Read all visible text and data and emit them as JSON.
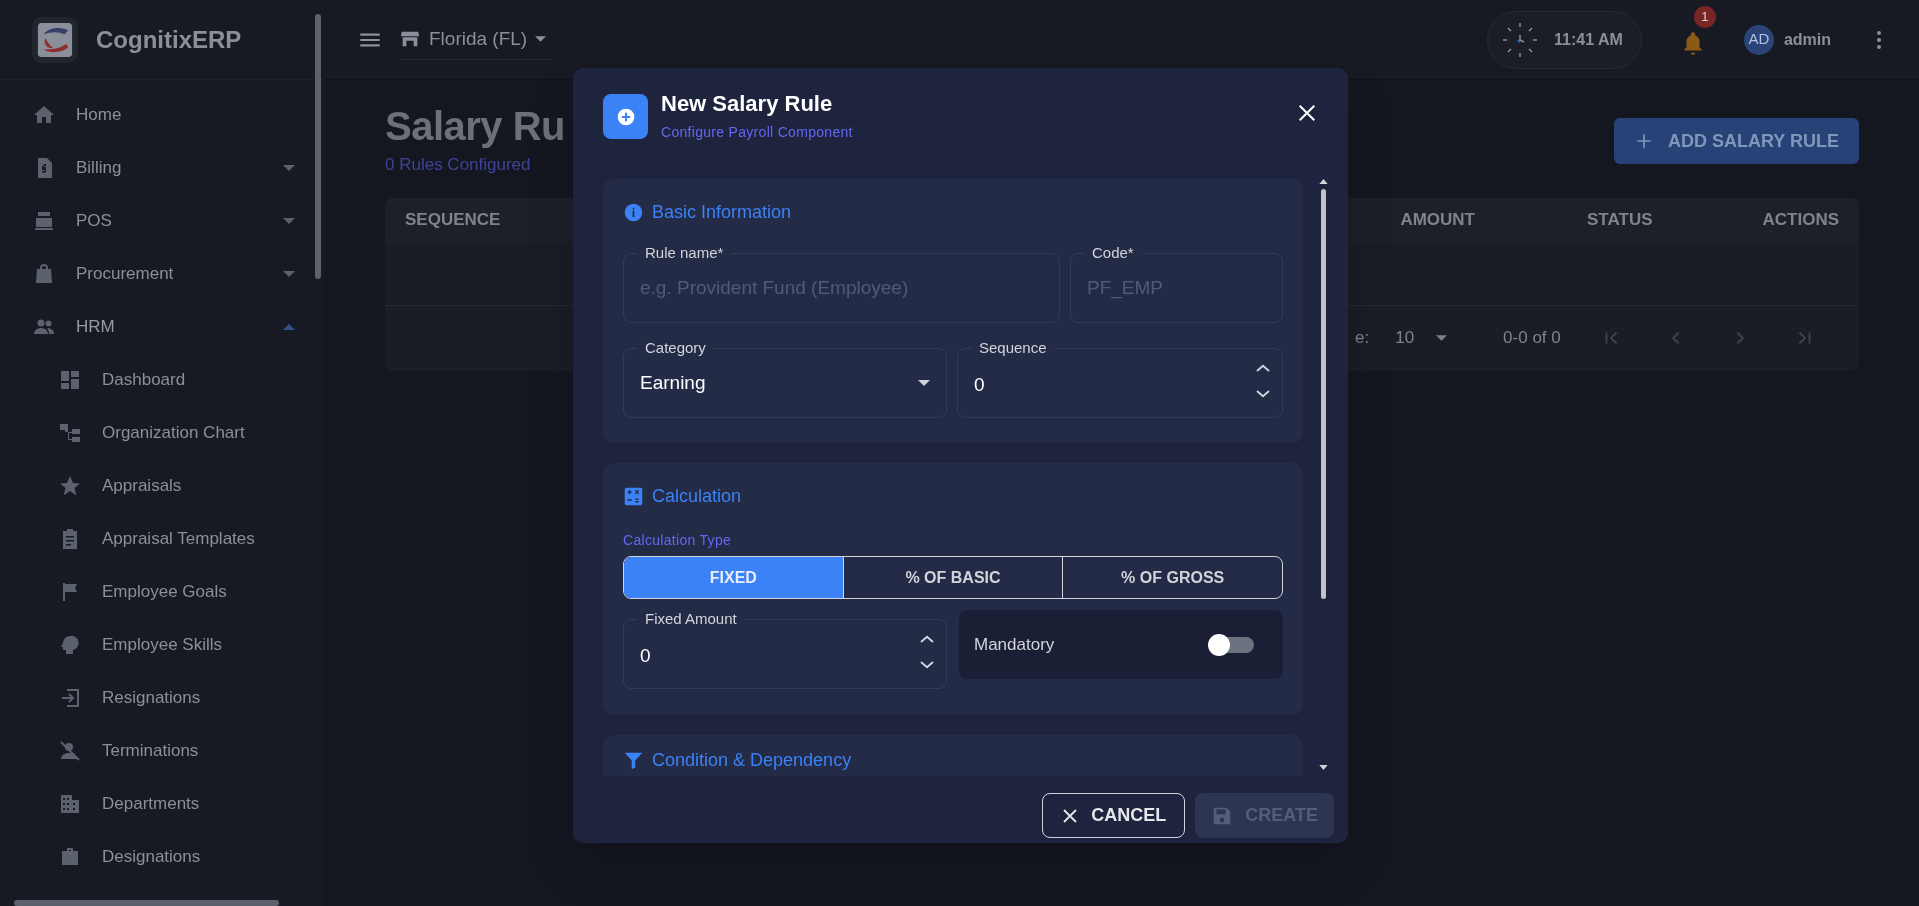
{
  "app": {
    "name": "CognitixERP"
  },
  "sidebar": {
    "items": [
      {
        "label": "Home",
        "kind": "link"
      },
      {
        "label": "Billing",
        "kind": "group",
        "expanded": false
      },
      {
        "label": "POS",
        "kind": "group",
        "expanded": false
      },
      {
        "label": "Procurement",
        "kind": "group",
        "expanded": false
      },
      {
        "label": "HRM",
        "kind": "group",
        "expanded": true,
        "children": [
          {
            "label": "Dashboard"
          },
          {
            "label": "Organization Chart"
          },
          {
            "label": "Appraisals"
          },
          {
            "label": "Appraisal Templates"
          },
          {
            "label": "Employee Goals"
          },
          {
            "label": "Employee Skills"
          },
          {
            "label": "Resignations"
          },
          {
            "label": "Terminations"
          },
          {
            "label": "Departments"
          },
          {
            "label": "Designations"
          }
        ]
      }
    ]
  },
  "topbar": {
    "location": "Florida (FL)",
    "time": "11:41 AM",
    "notifications": "1",
    "avatar": "AD",
    "user": "admin"
  },
  "page": {
    "title": "Salary Ru",
    "subtitle": "0 Rules Configured",
    "add_button": "ADD SALARY RULE",
    "table": {
      "columns": [
        {
          "label": "SEQUENCE"
        },
        {
          "label": "AMOUNT"
        },
        {
          "label": "STATUS"
        },
        {
          "label": "ACTIONS"
        }
      ],
      "pagination": {
        "rows_label": "e:",
        "rows_per_page": "10",
        "range": "0-0 of 0"
      }
    }
  },
  "dialog": {
    "title": "New Salary Rule",
    "subtitle": "Configure Payroll Component",
    "basic": {
      "title": "Basic Information",
      "rule_name": {
        "label": "Rule name*",
        "placeholder": "e.g. Provident Fund (Employee)"
      },
      "code": {
        "label": "Code*",
        "placeholder": "PF_EMP"
      },
      "category": {
        "label": "Category",
        "value": "Earning"
      },
      "sequence": {
        "label": "Sequence",
        "value": "0"
      }
    },
    "calculation": {
      "title": "Calculation",
      "type_label": "Calculation Type",
      "types": [
        {
          "label": "FIXED",
          "selected": true
        },
        {
          "label": "% OF BASIC",
          "selected": false
        },
        {
          "label": "% OF GROSS",
          "selected": false
        }
      ],
      "amount": {
        "label": "Fixed Amount",
        "value": "0"
      },
      "mandatory": {
        "label": "Mandatory",
        "on": false
      }
    },
    "condition": {
      "title": "Condition & Dependency"
    },
    "buttons": {
      "cancel": "CANCEL",
      "create": "CREATE",
      "create_disabled": true
    }
  }
}
